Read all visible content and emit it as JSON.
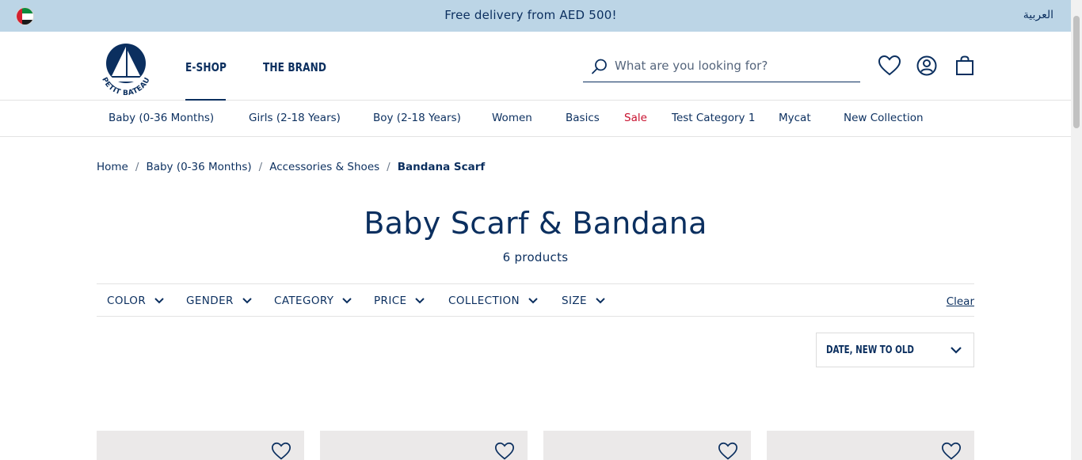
{
  "topbar": {
    "promo": "Free delivery from AED 500!",
    "language": "العربية",
    "flag_icon": "uae-flag-icon"
  },
  "header": {
    "logo_text": "PETIT BATEAU",
    "nav": [
      {
        "label": "E-SHOP",
        "active": true
      },
      {
        "label": "THE BRAND",
        "active": false
      }
    ],
    "search_placeholder": "What are you looking for?",
    "icons": [
      "search-icon",
      "heart-icon",
      "user-icon",
      "bag-icon"
    ]
  },
  "categories": [
    {
      "label": "Baby (0-36 Months)"
    },
    {
      "label": "Girls (2-18 Years)"
    },
    {
      "label": "Boy (2-18 Years)"
    },
    {
      "label": "Women"
    },
    {
      "label": "Basics"
    },
    {
      "label": "Sale",
      "color": "#c8102e"
    },
    {
      "label": "Test Category 1"
    },
    {
      "label": "Mycat"
    },
    {
      "label": "New Collection"
    }
  ],
  "breadcrumb": [
    "Home",
    "Baby (0-36 Months)",
    "Accessories & Shoes",
    "Bandana Scarf"
  ],
  "page": {
    "title": "Baby Scarf & Bandana",
    "count": "6 products"
  },
  "filters": [
    "COLOR",
    "GENDER",
    "CATEGORY",
    "PRICE",
    "COLLECTION",
    "SIZE"
  ],
  "clear_label": "Clear",
  "sort_label": "DATE, NEW TO OLD",
  "colors": {
    "navy": "#0b2f5f",
    "banner": "#bcd5e6",
    "sale": "#c8102e",
    "card_bg": "#ebe9e9"
  }
}
